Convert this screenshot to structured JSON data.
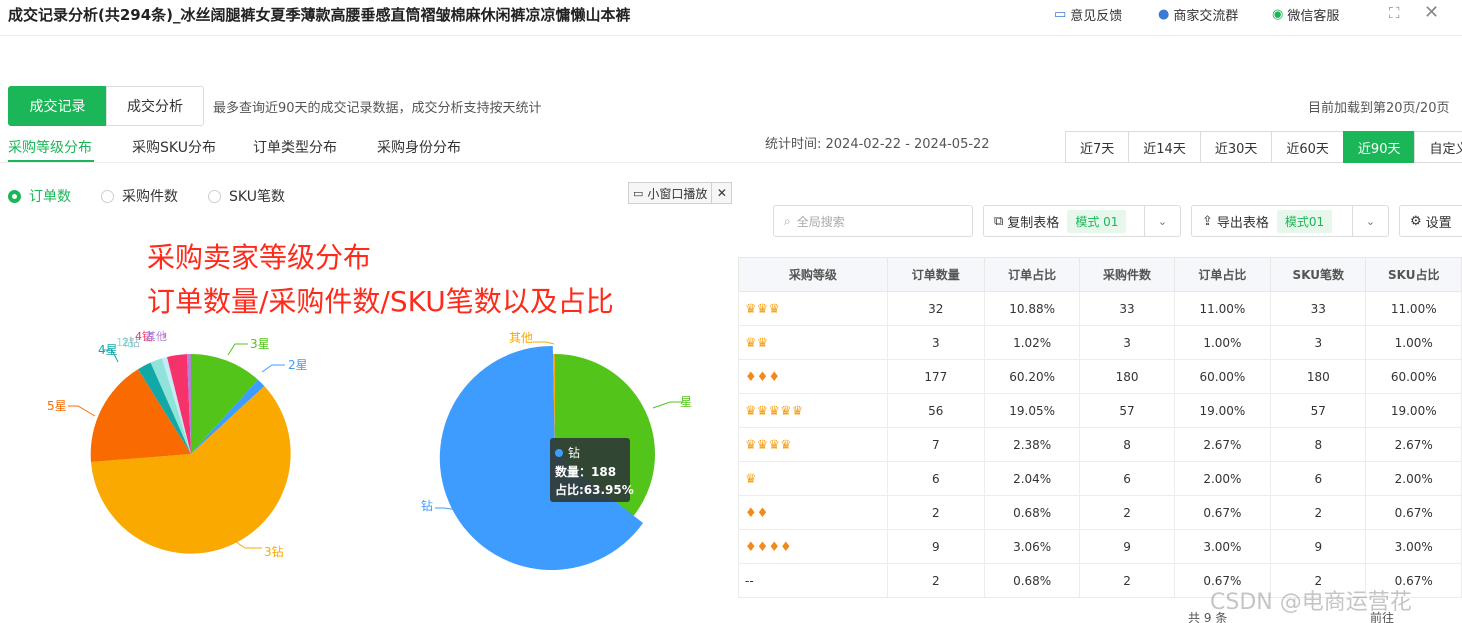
{
  "header": {
    "title": "成交记录分析(共294条)_冰丝阔腿裤女夏季薄款高腰垂感直筒褶皱棉麻休闲裤凉凉慵懒山本裤",
    "links": [
      "意见反馈",
      "商家交流群",
      "微信客服"
    ]
  },
  "main_tabs": {
    "active": "成交记录",
    "other": "成交分析"
  },
  "hint": "最多查询近90天的成交记录数据，成交分析支持按天统计",
  "loaded": "目前加载到第20页/20页",
  "subtabs": [
    "采购等级分布",
    "采购SKU分布",
    "订单类型分布",
    "采购身份分布"
  ],
  "stat_time": "统计时间: 2024-02-22 - 2024-05-22",
  "ranges": [
    "近7天",
    "近14天",
    "近30天",
    "近60天",
    "近90天",
    "自定义"
  ],
  "active_range": "近90天",
  "radios": [
    "订单数",
    "采购件数",
    "SKU笔数"
  ],
  "popout": "小窗口播放",
  "annotation": {
    "line1": "采购卖家等级分布",
    "line2": "订单数量/采购件数/SKU笔数以及占比"
  },
  "toolbar": {
    "search_placeholder": "全局搜索",
    "copy_label": "复制表格",
    "copy_mode": "模式 01",
    "export_label": "导出表格",
    "export_mode": "模式01",
    "settings_label": "设置"
  },
  "colors": {
    "green": "#1bb657",
    "orange_3zuan": "#f9a900",
    "orange_5star": "#f96b00",
    "pie2_blue": "#3f9cff",
    "pie2_green": "#52c41a"
  },
  "pie1_labels": {
    "l3xing": "3星",
    "l2xing": "2星",
    "l4xing": "4星",
    "l5xing": "5星",
    "l3zuan": "3钻",
    "lsmall": "1钻",
    "lsmall2": "2钻",
    "lsmall3": "4钻",
    "lother": "其他"
  },
  "pie2_labels": {
    "other": "其他",
    "xing": "星",
    "zuan": "钻"
  },
  "tooltip": {
    "name": "钻",
    "count": "数量：188",
    "ratio": "占比:63.95%"
  },
  "table": {
    "headers": [
      "采购等级",
      "订单数量",
      "订单占比",
      "采购件数",
      "订单占比",
      "SKU笔数",
      "SKU占比"
    ],
    "rows": [
      {
        "icon": "crown",
        "n": 3,
        "vals": [
          "32",
          "10.88%",
          "33",
          "11.00%",
          "33",
          "11.00%"
        ]
      },
      {
        "icon": "crown",
        "n": 2,
        "vals": [
          "3",
          "1.02%",
          "3",
          "1.00%",
          "3",
          "1.00%"
        ]
      },
      {
        "icon": "diamond",
        "n": 3,
        "vals": [
          "177",
          "60.20%",
          "180",
          "60.00%",
          "180",
          "60.00%"
        ]
      },
      {
        "icon": "crown",
        "n": 5,
        "vals": [
          "56",
          "19.05%",
          "57",
          "19.00%",
          "57",
          "19.00%"
        ]
      },
      {
        "icon": "crown",
        "n": 4,
        "vals": [
          "7",
          "2.38%",
          "8",
          "2.67%",
          "8",
          "2.67%"
        ]
      },
      {
        "icon": "crown",
        "n": 1,
        "vals": [
          "6",
          "2.04%",
          "6",
          "2.00%",
          "6",
          "2.00%"
        ]
      },
      {
        "icon": "diamond",
        "n": 2,
        "vals": [
          "2",
          "0.68%",
          "2",
          "0.67%",
          "2",
          "0.67%"
        ]
      },
      {
        "icon": "diamond",
        "n": 4,
        "vals": [
          "9",
          "3.06%",
          "9",
          "3.00%",
          "9",
          "3.00%"
        ]
      },
      {
        "icon": "none",
        "n": 0,
        "label": "--",
        "vals": [
          "2",
          "0.68%",
          "2",
          "0.67%",
          "2",
          "0.67%"
        ]
      }
    ]
  },
  "watermark": "CSDN @电商运营花",
  "pager": {
    "total": "共 9 条",
    "prev": "前往"
  }
}
